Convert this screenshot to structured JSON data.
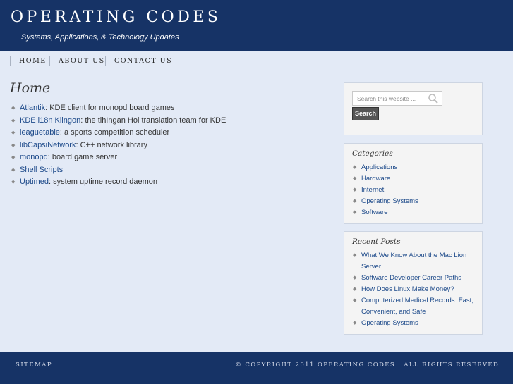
{
  "header": {
    "title": "OPERATING CODES",
    "description": "Systems, Applications, & Technology Updates"
  },
  "nav": {
    "items": [
      {
        "label": "HOME"
      },
      {
        "label": "ABOUT US"
      },
      {
        "label": "CONTACT US"
      }
    ]
  },
  "main": {
    "title": "Home",
    "items": [
      {
        "link": "Atlantik",
        "rest": ": KDE client for monopd board games"
      },
      {
        "link": "KDE i18n Klingon",
        "rest": ": the tlhIngan Hol translation team for KDE"
      },
      {
        "link": "leaguetable",
        "rest": ": a sports competition scheduler"
      },
      {
        "link": "libCapsiNetwork",
        "rest": ": C++ network library"
      },
      {
        "link": "monopd",
        "rest": ": board game server"
      },
      {
        "link": "Shell Scripts",
        "rest": ""
      },
      {
        "link": "Uptimed",
        "rest": ": system uptime record daemon"
      }
    ]
  },
  "sidebar": {
    "search": {
      "placeholder": "Search this website ...",
      "button_label": "Search"
    },
    "categories": {
      "title": "Categories",
      "items": [
        "Applications",
        "Hardware",
        "Internet",
        "Operating Systems",
        "Software"
      ]
    },
    "recent_posts": {
      "title": "Recent Posts",
      "items": [
        "What We Know About the Mac Lion Server",
        "Software Developer Career Paths",
        "How Does Linux Make Money?",
        "Computerized Medical Records: Fast, Convenient, and Safe",
        "Operating Systems"
      ]
    }
  },
  "footer": {
    "sitemap_label": "SITEMAP",
    "copyright": "© COPYRIGHT 2011 OPERATING CODES . ALL RIGHTS RESERVED."
  },
  "icons": {
    "bullet": "◆",
    "search": "magnifier"
  },
  "colors": {
    "header_bg": "#163366",
    "page_bg": "#e3eaf6",
    "link": "#1d4a8a"
  }
}
